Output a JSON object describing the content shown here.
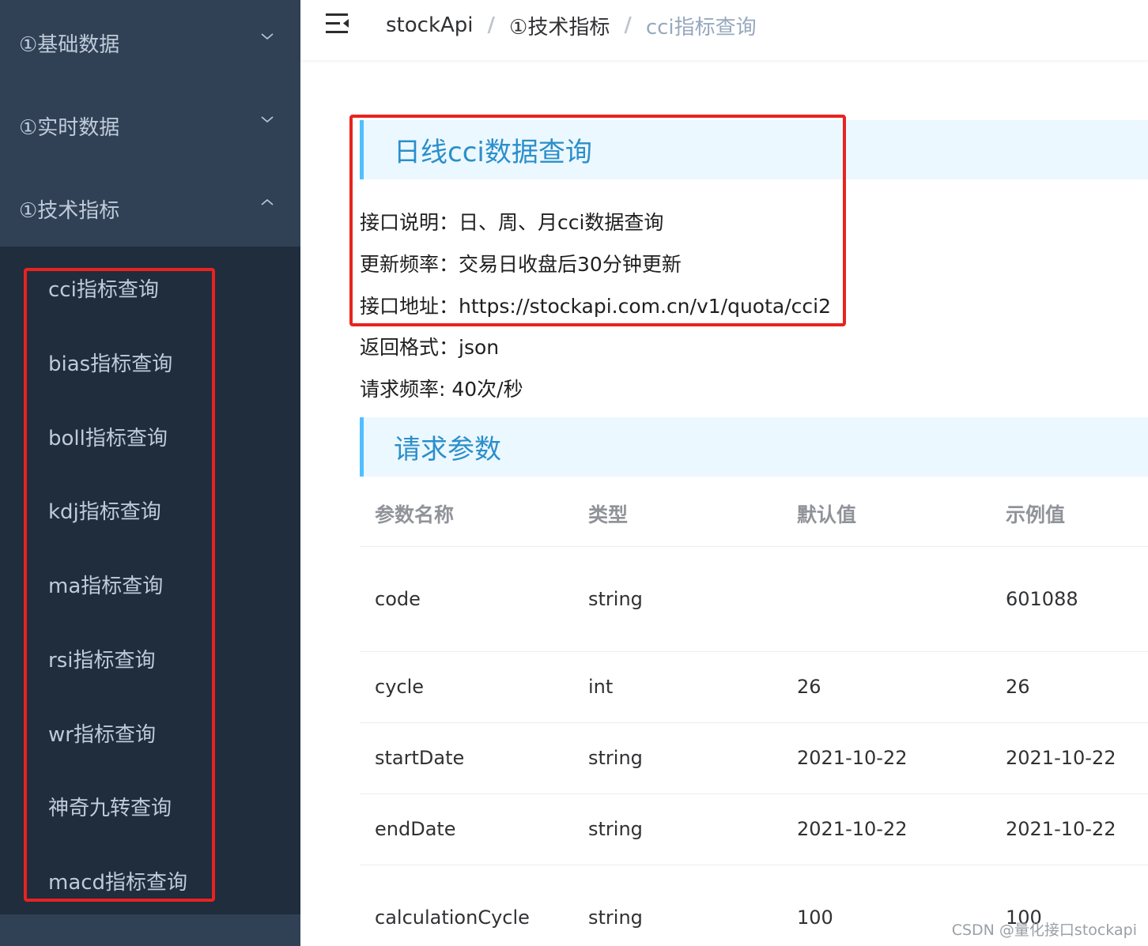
{
  "sidebar": {
    "groups": [
      {
        "label": "①基础数据",
        "icon": "chevron-down-icon"
      },
      {
        "label": "①实时数据",
        "icon": "chevron-down-icon"
      },
      {
        "label": "①技术指标",
        "icon": "chevron-up-icon"
      }
    ],
    "sub_items": [
      {
        "label": "cci指标查询"
      },
      {
        "label": "bias指标查询"
      },
      {
        "label": "boll指标查询"
      },
      {
        "label": "kdj指标查询"
      },
      {
        "label": "ma指标查询"
      },
      {
        "label": "rsi指标查询"
      },
      {
        "label": "wr指标查询"
      },
      {
        "label": "神奇九转查询"
      },
      {
        "label": "macd指标查询"
      }
    ]
  },
  "navbar": {
    "hamburger_icon": "menu-fold-icon",
    "breadcrumb": [
      "stockApi",
      "①技术指标",
      "cci指标查询"
    ],
    "separator": "/"
  },
  "main": {
    "title": "日线cci数据查询",
    "info": [
      "接口说明：日、周、月cci数据查询",
      "更新频率：交易日收盘后30分钟更新",
      "接口地址：https://stockapi.com.cn/v1/quota/cci2",
      "返回格式：json",
      "请求频率: 40次/秒"
    ],
    "params_title": "请求参数",
    "table": {
      "headers": [
        "参数名称",
        "类型",
        "默认值",
        "示例值"
      ],
      "rows": [
        [
          "code",
          "string",
          "",
          "601088"
        ],
        [
          "cycle",
          "int",
          "26",
          "26"
        ],
        [
          "startDate",
          "string",
          "2021-10-22",
          "2021-10-22"
        ],
        [
          "endDate",
          "string",
          "2021-10-22",
          "2021-10-22"
        ],
        [
          "calculationCycle",
          "string",
          "100",
          "100"
        ]
      ]
    }
  },
  "watermark": "CSDN @量化接口stockapi",
  "colors": {
    "sidebar_bg": "#304156",
    "submenu_bg": "#1f2d3d",
    "accent": "#2b8fcb",
    "highlight_border": "#e8231f"
  }
}
